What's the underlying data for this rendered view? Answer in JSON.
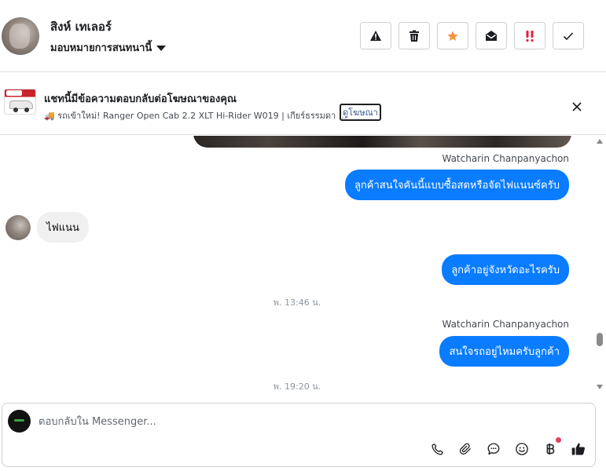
{
  "header": {
    "contact_name": "สิงห์ เทเลอร์",
    "assign_label": "มอบหมายการสนทนานี้",
    "actions": [
      {
        "name": "spam",
        "icon": "warning-icon"
      },
      {
        "name": "delete",
        "icon": "trash-icon"
      },
      {
        "name": "follow-up",
        "icon": "star-icon",
        "color": "#f7923b"
      },
      {
        "name": "mark-unread",
        "icon": "envelope-open-icon"
      },
      {
        "name": "important",
        "icon": "exclamation-icon",
        "color": "#e41e3f"
      },
      {
        "name": "done",
        "icon": "check-icon"
      }
    ]
  },
  "ad_banner": {
    "title": "แชทนี้มีข้อความตอบกลับต่อโฆษณาของคุณ",
    "description": "🚚 รถเข้าใหม่! Ranger Open Cab 2.2 XLT Hi-Rider W019 | เกียร์ธรรมดา ...",
    "view_ad_label": "ดูโฆษณา"
  },
  "conversation": {
    "messages": [
      {
        "type": "out",
        "sender": "Watcharin Chanpanyachon",
        "text": "ลูกค้าสนใจคันนี้แบบซื้อสดหรือจัดไฟแนนซ์ครับ"
      },
      {
        "type": "in",
        "text": "ไฟแนน"
      },
      {
        "type": "out",
        "text": "ลูกค้าอยู่จังหวัดอะไรครับ"
      },
      {
        "type": "time",
        "text": "พ. 13:46 น."
      },
      {
        "type": "out",
        "sender": "Watcharin Chanpanyachon",
        "text": "สนใจรถอยู่ไหมครับลูกค้า"
      },
      {
        "type": "time",
        "text": "พ. 19:20 น."
      }
    ]
  },
  "composer": {
    "placeholder": "ตอบกลับใน Messenger...",
    "tools": [
      "phone-icon",
      "paperclip-icon",
      "chat-bubble-icon",
      "emoji-icon",
      "baht-icon",
      "thumbs-up-icon"
    ]
  },
  "colors": {
    "outgoing_bubble": "#0a7cff",
    "incoming_bubble": "#f0f0f0",
    "border": "#ccd0d5",
    "star": "#f7923b",
    "important": "#e41e3f"
  }
}
